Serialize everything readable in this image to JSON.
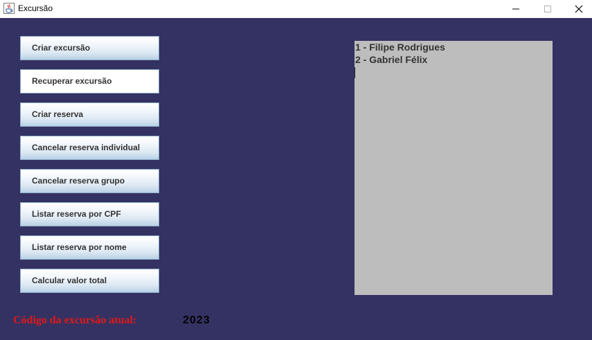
{
  "window": {
    "title": "Excursão",
    "app_icon": "java-cup-icon",
    "controls": [
      "minimize-icon",
      "maximize-icon",
      "close-icon"
    ]
  },
  "menu_buttons": [
    {
      "label": "Criar excursão"
    },
    {
      "label": "Recuperar excursão",
      "selected": true
    },
    {
      "label": "Criar reserva"
    },
    {
      "label": "Cancelar reserva individual"
    },
    {
      "label": "Cancelar reserva grupo"
    },
    {
      "label": "Listar reserva por CPF"
    },
    {
      "label": "Listar reserva por nome"
    },
    {
      "label": "Calcular valor total"
    }
  ],
  "list_area": {
    "items": [
      "1 - Filipe Rodrigues",
      "2 - Gabriel Félix"
    ]
  },
  "footer": {
    "code_label": "Código da excursão atual:",
    "code_value": "2023"
  },
  "colors": {
    "background": "#343262",
    "list_background": "#bdbdbd",
    "label_red": "#e01818"
  }
}
